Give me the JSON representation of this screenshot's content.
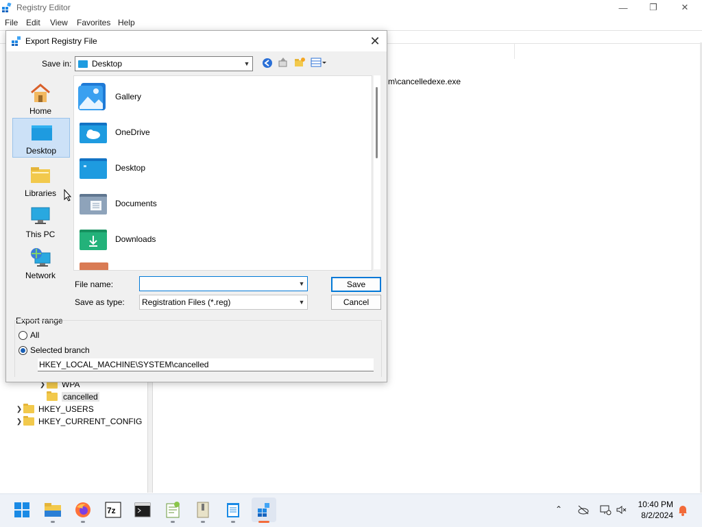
{
  "app": {
    "title": "Registry Editor",
    "menu": [
      "File",
      "Edit",
      "View",
      "Favorites",
      "Help"
    ],
    "right_pane_value_fragment": "m\\cancelledexe.exe"
  },
  "tree": [
    {
      "label": "WPA",
      "expandable": true
    },
    {
      "label": "cancelled",
      "expandable": false,
      "selected": true
    },
    {
      "label": "HKEY_USERS",
      "expandable": true
    },
    {
      "label": "HKEY_CURRENT_CONFIG",
      "expandable": true
    }
  ],
  "dialog": {
    "title": "Export Registry File",
    "save_in_label": "Save in:",
    "save_in_value": "Desktop",
    "places": [
      {
        "label": "Home",
        "icon": "home-icon"
      },
      {
        "label": "Desktop",
        "icon": "desktop-icon",
        "active": true
      },
      {
        "label": "Libraries",
        "icon": "libraries-icon"
      },
      {
        "label": "This PC",
        "icon": "this-pc-icon"
      },
      {
        "label": "Network",
        "icon": "network-icon"
      }
    ],
    "files": [
      {
        "label": "Gallery",
        "icon": "gallery-icon"
      },
      {
        "label": "OneDrive",
        "icon": "onedrive-folder-icon"
      },
      {
        "label": "Desktop",
        "icon": "desktop-folder-icon"
      },
      {
        "label": "Documents",
        "icon": "documents-folder-icon"
      },
      {
        "label": "Downloads",
        "icon": "downloads-folder-icon"
      }
    ],
    "file_name_label": "File name:",
    "file_name_value": "",
    "save_type_label": "Save as type:",
    "save_type_value": "Registration Files (*.reg)",
    "save_button": "Save",
    "cancel_button": "Cancel",
    "export_range_label": "Export range",
    "radio_all": "All",
    "radio_selected": "Selected branch",
    "branch_value": "HKEY_LOCAL_MACHINE\\SYSTEM\\cancelled"
  },
  "taskbar": {
    "apps": [
      "start-icon",
      "file-explorer-icon",
      "firefox-icon",
      "7zip-icon",
      "terminal-icon",
      "notepad-plus-icon",
      "archive-icon",
      "notepad-icon",
      "registry-editor-icon"
    ],
    "time": "10:40 PM",
    "date": "8/2/2024"
  },
  "colors": {
    "accent": "#0078d7",
    "selection": "#cce1f7",
    "taskbar_bg": "#eef2f8"
  }
}
